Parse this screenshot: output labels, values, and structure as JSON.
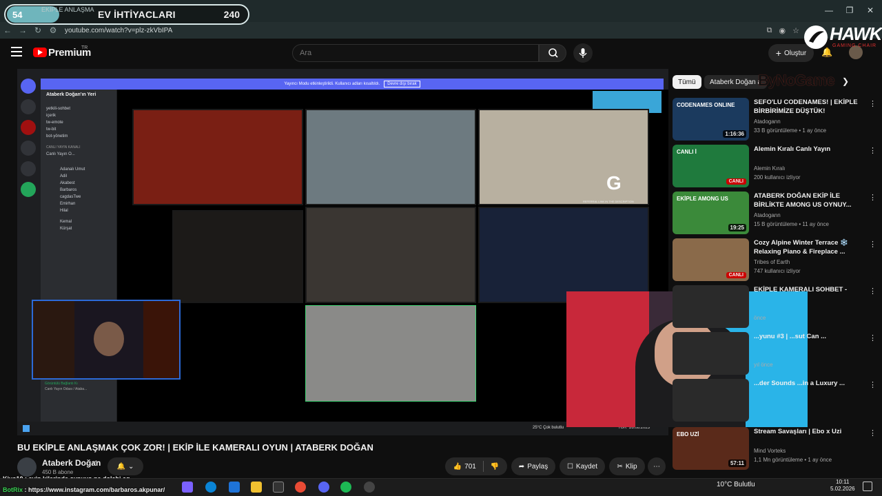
{
  "browser": {
    "tab_ghost": "EKİPLE ANLAŞMA",
    "overlay": {
      "badge": "54",
      "title": "EV İHTİYACLARI",
      "count": "240"
    },
    "url": "youtube.com/watch?v=plz-zkVbIPA"
  },
  "header": {
    "brand": "Premium",
    "region": "TR",
    "search_placeholder": "Ara",
    "create_label": "Oluştur"
  },
  "overlay_logos": {
    "hawk": "HAWK",
    "hawk_sub": "GAMING CHAIR",
    "bynogame": "ByNoGame"
  },
  "video": {
    "discord": {
      "server": "Ataberk Doğan'ın Yeri",
      "banner": "Yayıncı Modu etkinleştirildi. Kullanıcı adları kısaltıldı.",
      "banner_btn": "Devre dışı bırak",
      "channels": [
        "yetkili-sohbet",
        "içerik",
        "tw-emote",
        "tw-bit",
        "bot-yönetim"
      ],
      "section": "CANLI YAYIN KANALI",
      "voice_channel": "Canlı Yayın O...",
      "users": [
        "Adanalı Umut",
        "Adil",
        "Akabest",
        "Barbaros",
        "cagdasTwe",
        "Emirhan",
        "Hilal",
        "Kemal",
        "Kürşat"
      ],
      "voice_status": "Görüntülü Bağlantı Kı",
      "voice_sub": "Canlı Yayın Odası / Ataba...",
      "tile_logo": "G",
      "tile_caption": "REFERRAL LINK IN THE DESCRIPTION",
      "taskbar_weather": "25°C  Çok bulutlu",
      "taskbar_lang": "TUR",
      "taskbar_date": "26.08.2023"
    }
  },
  "meta": {
    "title": "BU EKİPLE ANLAŞMAK ÇOK ZOR! | EKİP İLE KAMERALI OYUN | ATABERK DOĞAN",
    "channel": "Ataberk Doğan",
    "subscribers": "450 B abone",
    "likes": "701",
    "share": "Paylaş",
    "save": "Kaydet",
    "clip": "Klip"
  },
  "sidebar": {
    "chips": [
      "Tümü",
      "Ataberk Doğan a"
    ],
    "recs": [
      {
        "title": "SEFO'LU CODENAMES! | EKİPLE BİRBİRİMİZE DÜŞTÜK!",
        "channel": "Atadogann",
        "meta": "33 B görüntüleme • 1 ay önce",
        "duration": "1:16:36",
        "thumb": "#1b3a5e",
        "thumb_text": "CODENAMES ONLINE"
      },
      {
        "title": "Alemin Kıralı Canlı Yayın",
        "channel": "Alemin Kıralı",
        "meta": "200 kullanıcı izliyor",
        "live": "CANLI",
        "thumb": "#1f7a3d",
        "thumb_text": "CANLI İ"
      },
      {
        "title": "ATABERK DOĞAN EKİP İLE BİRLİKTE AMONG US OYNUY...",
        "channel": "Atadogann",
        "meta": "15 B görüntüleme • 11 ay önce",
        "duration": "19:25",
        "thumb": "#3b8a3a",
        "thumb_text": "EKİPLE AMONG US"
      },
      {
        "title": "Cozy Alpine Winter Terrace ❄️ Relaxing Piano & Fireplace ...",
        "channel": "Tribes of Earth",
        "meta": "747 kullanıcı izliyor",
        "live": "CANLI",
        "thumb": "#8a6a4a",
        "thumb_text": ""
      },
      {
        "title": "EKİPLE KAMERALI SOHBET - ",
        "channel": "",
        "meta": "önce",
        "thumb": "#2a2a2a",
        "thumb_text": ""
      },
      {
        "title": "...yunu #3 | ...sut Can ...",
        "channel": "",
        "meta": "yıl önce",
        "thumb": "#2a2a2a",
        "thumb_text": ""
      },
      {
        "title": "...der Sounds ...in a Luxury ...",
        "channel": "",
        "meta": "",
        "thumb": "#2a2a2a",
        "thumb_text": ""
      },
      {
        "title": "Stream Savaşları | Ebo x Uzi",
        "channel": "Mind Vorteks",
        "meta": "1,1 Mn görüntüleme • 1 ay önce",
        "duration": "57:11",
        "thumb": "#5a2a1a",
        "thumb_text": "EBO UZİ"
      }
    ]
  },
  "chat": [
    {
      "user": "Kivo10",
      "text": "evin kilerinde oynuyo ne dolabi aq"
    },
    {
      "user": "BotRix",
      "text": "https://www.instagram.com/barbaros.akpunar/"
    }
  ],
  "taskbar": {
    "weather": "10°C  Bulutlu",
    "time": "10:11",
    "date": "5.02.2026"
  },
  "colors": {
    "yt_red": "#ff0000",
    "discord_purple": "#5865f2",
    "like_bg": "#272727"
  }
}
